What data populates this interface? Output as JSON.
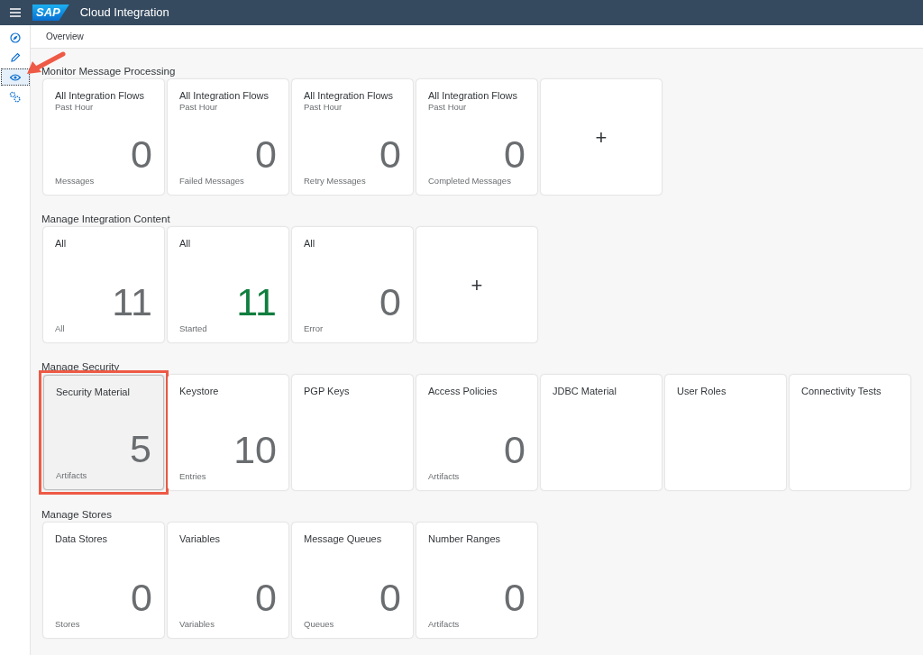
{
  "header": {
    "title": "Cloud Integration",
    "logo": "SAP"
  },
  "sidebar": {
    "items": [
      {
        "kind": "compass",
        "selected": false
      },
      {
        "kind": "pencil",
        "selected": false
      },
      {
        "kind": "eye",
        "selected": true
      },
      {
        "kind": "gears",
        "selected": false
      }
    ]
  },
  "breadcrumb": "Overview",
  "annotation_arrow": true,
  "sections": [
    {
      "title": "Monitor Message Processing",
      "tiles": [
        {
          "kind": "kpi",
          "title": "All Integration Flows",
          "subtitle": "Past Hour",
          "value": "0",
          "footer": "Messages",
          "color": "#6a6d70",
          "selected": false,
          "highlighted": false
        },
        {
          "kind": "kpi",
          "title": "All Integration Flows",
          "subtitle": "Past Hour",
          "value": "0",
          "footer": "Failed Messages",
          "color": "#6a6d70",
          "selected": false,
          "highlighted": false
        },
        {
          "kind": "kpi",
          "title": "All Integration Flows",
          "subtitle": "Past Hour",
          "value": "0",
          "footer": "Retry Messages",
          "color": "#6a6d70",
          "selected": false,
          "highlighted": false
        },
        {
          "kind": "kpi",
          "title": "All Integration Flows",
          "subtitle": "Past Hour",
          "value": "0",
          "footer": "Completed Messages",
          "color": "#6a6d70",
          "selected": false,
          "highlighted": false
        },
        {
          "kind": "add",
          "label": "+"
        }
      ]
    },
    {
      "title": "Manage Integration Content",
      "tiles": [
        {
          "kind": "kpi",
          "title": "All",
          "value": "11",
          "footer": "All",
          "color": "#6a6d70",
          "selected": false,
          "highlighted": false
        },
        {
          "kind": "kpi",
          "title": "All",
          "value": "11",
          "footer": "Started",
          "color": "#107e3e",
          "selected": false,
          "highlighted": false
        },
        {
          "kind": "kpi",
          "title": "All",
          "value": "0",
          "footer": "Error",
          "color": "#6a6d70",
          "selected": false,
          "highlighted": false
        },
        {
          "kind": "add",
          "label": "+"
        }
      ]
    },
    {
      "title": "Manage Security",
      "tiles": [
        {
          "kind": "kpi",
          "title": "Security Material",
          "value": "5",
          "footer": "Artifacts",
          "color": "#6a6d70",
          "selected": true,
          "highlighted": true
        },
        {
          "kind": "kpi",
          "title": "Keystore",
          "value": "10",
          "footer": "Entries",
          "color": "#6a6d70",
          "selected": false,
          "highlighted": false
        },
        {
          "kind": "kpi",
          "title": "PGP Keys",
          "selected": false,
          "highlighted": false
        },
        {
          "kind": "kpi",
          "title": "Access Policies",
          "value": "0",
          "footer": "Artifacts",
          "color": "#6a6d70",
          "selected": false,
          "highlighted": false
        },
        {
          "kind": "kpi",
          "title": "JDBC Material",
          "selected": false,
          "highlighted": false
        },
        {
          "kind": "kpi",
          "title": "User Roles",
          "selected": false,
          "highlighted": false
        },
        {
          "kind": "kpi",
          "title": "Connectivity Tests",
          "selected": false,
          "highlighted": false
        }
      ]
    },
    {
      "title": "Manage Stores",
      "tiles": [
        {
          "kind": "kpi",
          "title": "Data Stores",
          "value": "0",
          "footer": "Stores",
          "color": "#6a6d70",
          "selected": false,
          "highlighted": false
        },
        {
          "kind": "kpi",
          "title": "Variables",
          "value": "0",
          "footer": "Variables",
          "color": "#6a6d70",
          "selected": false,
          "highlighted": false
        },
        {
          "kind": "kpi",
          "title": "Message Queues",
          "value": "0",
          "footer": "Queues",
          "color": "#6a6d70",
          "selected": false,
          "highlighted": false
        },
        {
          "kind": "kpi",
          "title": "Number Ranges",
          "value": "0",
          "footer": "Artifacts",
          "color": "#6a6d70",
          "selected": false,
          "highlighted": false
        }
      ]
    }
  ]
}
